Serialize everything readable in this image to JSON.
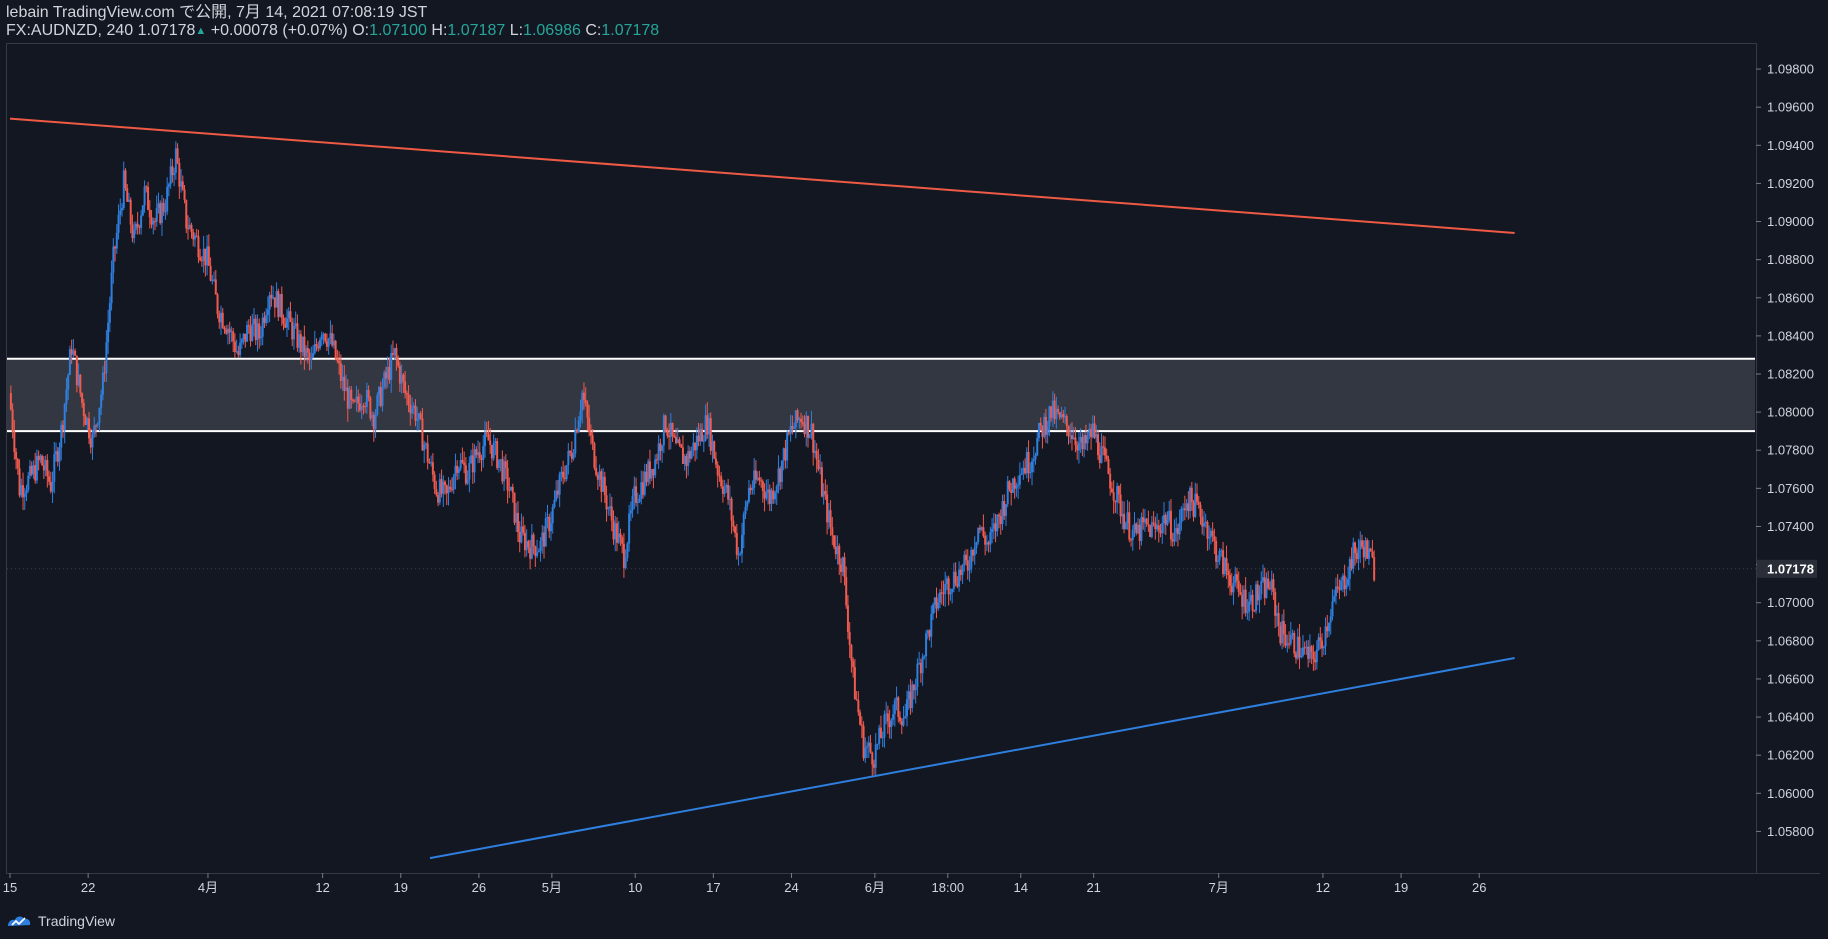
{
  "header": {
    "publish_line": "lebain TradingView.com で公開, 7月 14, 2021 07:08:19 JST",
    "symbol_line": "FX:AUDNZD, 240 1.07178",
    "change": "+0.00078 (+0.07%)",
    "o_label": "O:",
    "o_value": "1.07100",
    "h_label": "H:",
    "h_value": "1.07187",
    "l_label": "L:",
    "l_value": "1.06986",
    "c_label": "C:",
    "c_value": "1.07178"
  },
  "footer": {
    "brand": "TradingView"
  },
  "colors": {
    "background": "#131722",
    "up": "#2f7fdf",
    "down": "#f15a4f",
    "resistance_line": "#ef5a45",
    "support_line": "#2f7fdf",
    "zone_fill": "#3a3d47",
    "zone_border": "#ffffff",
    "axis_text": "#d1d4dc"
  },
  "chart_data": {
    "type": "candlestick",
    "symbol": "FX:AUDNZD",
    "interval": "240",
    "ylim": [
      1.0565,
      1.099
    ],
    "y_ticks": [
      "1.05800",
      "1.06000",
      "1.06200",
      "1.06400",
      "1.06600",
      "1.06800",
      "1.07000",
      "1.07200",
      "1.07400",
      "1.07600",
      "1.07800",
      "1.08000",
      "1.08200",
      "1.08400",
      "1.08600",
      "1.08800",
      "1.09000",
      "1.09200",
      "1.09400",
      "1.09600",
      "1.09800"
    ],
    "x_ticks": [
      "15",
      "22",
      "4月",
      "12",
      "19",
      "26",
      "5月",
      "10",
      "17",
      "24",
      "6月",
      "18:00",
      "14",
      "21",
      "7月",
      "12",
      "19",
      "26"
    ],
    "x_tick_index": [
      0,
      7.5,
      19,
      30,
      37.5,
      45,
      52,
      60,
      67.5,
      75,
      83,
      90,
      97,
      104,
      116,
      126,
      133.5,
      141
    ],
    "last_price": "1.07178",
    "close_path": [
      [
        0,
        1.081
      ],
      [
        1,
        1.076
      ],
      [
        2,
        1.0765
      ],
      [
        3,
        1.0775
      ],
      [
        4,
        1.0762
      ],
      [
        5,
        1.079
      ],
      [
        6,
        1.0835
      ],
      [
        7,
        1.0805
      ],
      [
        8,
        1.0785
      ],
      [
        9,
        1.0815
      ],
      [
        10,
        1.088
      ],
      [
        11,
        1.092
      ],
      [
        12,
        1.089
      ],
      [
        13,
        1.0915
      ],
      [
        14,
        1.09
      ],
      [
        15,
        1.091
      ],
      [
        16,
        1.0935
      ],
      [
        17,
        1.09
      ],
      [
        18,
        1.089
      ],
      [
        19,
        1.088
      ],
      [
        20,
        1.0855
      ],
      [
        21,
        1.0845
      ],
      [
        22,
        1.083
      ],
      [
        23,
        1.0845
      ],
      [
        24,
        1.084
      ],
      [
        25,
        1.0865
      ],
      [
        26,
        1.0855
      ],
      [
        27,
        1.0845
      ],
      [
        28,
        1.0835
      ],
      [
        29,
        1.0825
      ],
      [
        30,
        1.0845
      ],
      [
        31,
        1.0835
      ],
      [
        32,
        1.0815
      ],
      [
        33,
        1.08
      ],
      [
        34,
        1.081
      ],
      [
        35,
        1.0798
      ],
      [
        36,
        1.0815
      ],
      [
        37,
        1.083
      ],
      [
        38,
        1.081
      ],
      [
        39,
        1.08
      ],
      [
        40,
        1.078
      ],
      [
        41,
        1.076
      ],
      [
        42,
        1.0755
      ],
      [
        43,
        1.0775
      ],
      [
        44,
        1.0768
      ],
      [
        45,
        1.078
      ],
      [
        46,
        1.0785
      ],
      [
        47,
        1.0775
      ],
      [
        48,
        1.076
      ],
      [
        49,
        1.0735
      ],
      [
        50,
        1.073
      ],
      [
        51,
        1.073
      ],
      [
        52,
        1.0745
      ],
      [
        53,
        1.0765
      ],
      [
        54,
        1.078
      ],
      [
        55,
        1.081
      ],
      [
        56,
        1.078
      ],
      [
        57,
        1.076
      ],
      [
        58,
        1.074
      ],
      [
        59,
        1.0725
      ],
      [
        60,
        1.0755
      ],
      [
        61,
        1.0765
      ],
      [
        62,
        1.0775
      ],
      [
        63,
        1.0795
      ],
      [
        64,
        1.078
      ],
      [
        65,
        1.0775
      ],
      [
        66,
        1.0785
      ],
      [
        67,
        1.0795
      ],
      [
        68,
        1.077
      ],
      [
        69,
        1.0755
      ],
      [
        70,
        1.0725
      ],
      [
        71,
        1.076
      ],
      [
        72,
        1.0765
      ],
      [
        73,
        1.0755
      ],
      [
        74,
        1.077
      ],
      [
        75,
        1.079
      ],
      [
        76,
        1.0798
      ],
      [
        77,
        1.079
      ],
      [
        78,
        1.076
      ],
      [
        79,
        1.0735
      ],
      [
        80,
        1.072
      ],
      [
        81,
        1.066
      ],
      [
        82,
        1.0625
      ],
      [
        83,
        1.062
      ],
      [
        84,
        1.0635
      ],
      [
        85,
        1.0645
      ],
      [
        86,
        1.064
      ],
      [
        87,
        1.066
      ],
      [
        88,
        1.068
      ],
      [
        89,
        1.07
      ],
      [
        90,
        1.071
      ],
      [
        91,
        1.0715
      ],
      [
        92,
        1.072
      ],
      [
        93,
        1.074
      ],
      [
        94,
        1.073
      ],
      [
        95,
        1.0745
      ],
      [
        96,
        1.076
      ],
      [
        97,
        1.077
      ],
      [
        98,
        1.0775
      ],
      [
        99,
        1.079
      ],
      [
        100,
        1.08
      ],
      [
        101,
        1.0795
      ],
      [
        102,
        1.079
      ],
      [
        103,
        1.078
      ],
      [
        104,
        1.079
      ],
      [
        105,
        1.0775
      ],
      [
        106,
        1.076
      ],
      [
        107,
        1.0745
      ],
      [
        108,
        1.0735
      ],
      [
        109,
        1.074
      ],
      [
        110,
        1.0738
      ],
      [
        111,
        1.0745
      ],
      [
        112,
        1.0735
      ],
      [
        113,
        1.0755
      ],
      [
        114,
        1.075
      ],
      [
        115,
        1.074
      ],
      [
        116,
        1.0725
      ],
      [
        117,
        1.0715
      ],
      [
        118,
        1.0705
      ],
      [
        119,
        1.07
      ],
      [
        120,
        1.0705
      ],
      [
        121,
        1.071
      ],
      [
        122,
        1.0685
      ],
      [
        123,
        1.068
      ],
      [
        124,
        1.0675
      ],
      [
        125,
        1.067
      ],
      [
        126,
        1.068
      ],
      [
        127,
        1.07
      ],
      [
        128,
        1.071
      ],
      [
        129,
        1.0725
      ],
      [
        130,
        1.073
      ],
      [
        131,
        1.0718
      ]
    ],
    "trendlines": [
      {
        "name": "resistance",
        "from": [
          0,
          1.0954
        ],
        "to": [
          144.4,
          1.0894
        ]
      },
      {
        "name": "support",
        "from": [
          40.3,
          1.0566
        ],
        "to": [
          144.4,
          1.0671
        ]
      }
    ],
    "zone": {
      "top": 1.0828,
      "bottom": 1.079
    }
  }
}
